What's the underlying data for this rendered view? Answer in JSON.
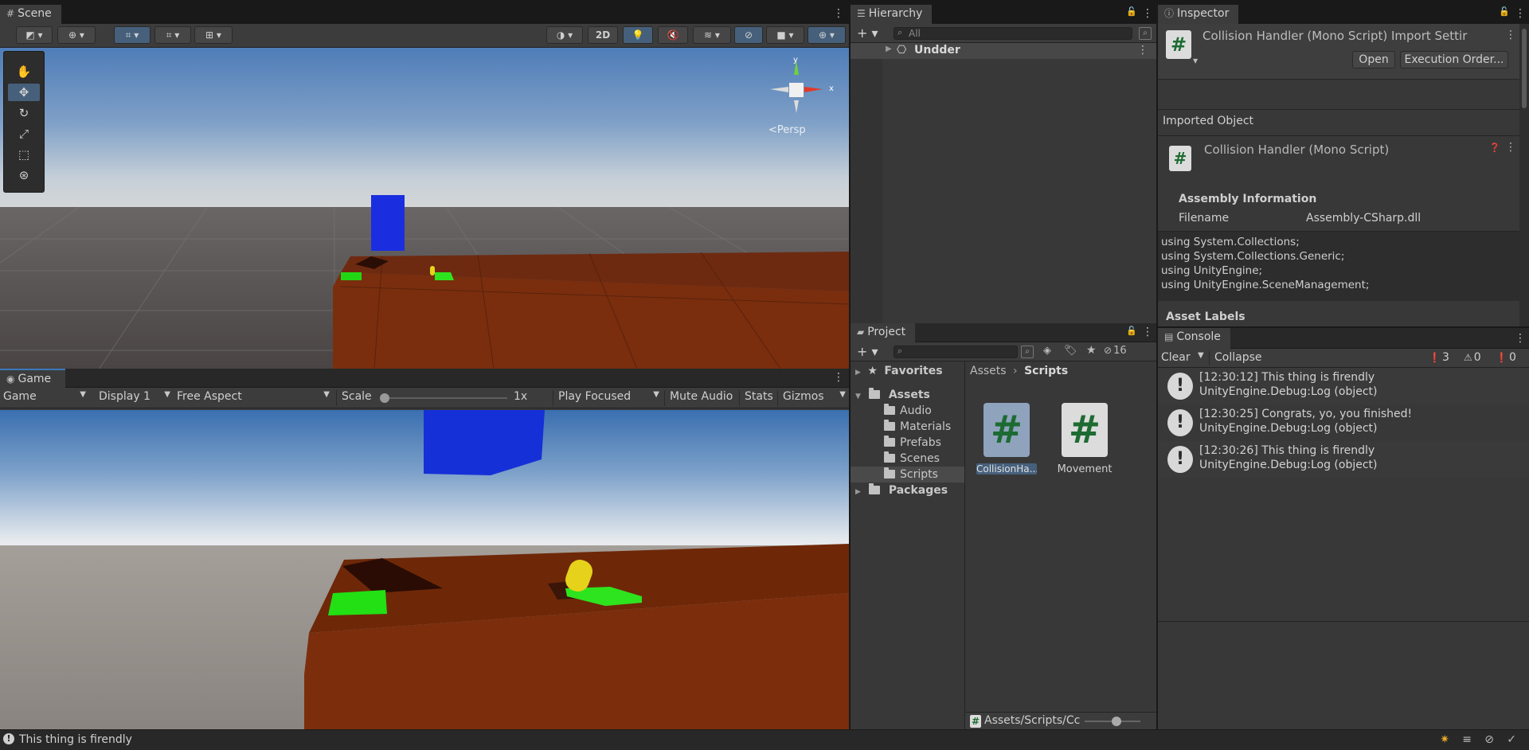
{
  "scene": {
    "tab_label": "Scene",
    "toolbar": {
      "btn_2d": "2D"
    },
    "gizmo": {
      "axis_x": "x",
      "axis_y": "y",
      "persp_label": "<Persp"
    }
  },
  "game": {
    "tab_label": "Game",
    "toolbar": {
      "mode": "Game",
      "display": "Display 1",
      "aspect": "Free Aspect",
      "scale_label": "Scale",
      "scale_value": "1x",
      "scale_level": 0,
      "play_mode": "Play Focused",
      "mute": "Mute Audio",
      "stats": "Stats",
      "gizmos": "Gizmos"
    }
  },
  "hierarchy": {
    "tab_label": "Hierarchy",
    "search_placeholder": "All",
    "scene_name": "Undder"
  },
  "inspector": {
    "tab_label": "Inspector",
    "title": "Collision Handler (Mono Script) Import Settir",
    "open_label": "Open",
    "execution_order_label": "Execution Order...",
    "imported_object_label": "Imported Object",
    "imported_object_title": "Collision Handler (Mono Script)",
    "assembly_header": "Assembly Information",
    "filename_label": "Filename",
    "filename_value": "Assembly-CSharp.dll",
    "code_lines": [
      "using System.Collections;",
      "using System.Collections.Generic;",
      "using UnityEngine;",
      "using UnityEngine.SceneManagement;"
    ],
    "asset_labels": "Asset Labels"
  },
  "project": {
    "tab_label": "Project",
    "hidden_count": "16",
    "tree": [
      {
        "label": "Favorites",
        "depth": 0,
        "bold": true
      },
      {
        "label": "Assets",
        "depth": 0,
        "bold": true
      },
      {
        "label": "Audio",
        "depth": 1
      },
      {
        "label": "Materials",
        "depth": 1
      },
      {
        "label": "Prefabs",
        "depth": 1
      },
      {
        "label": "Scenes",
        "depth": 1
      },
      {
        "label": "Scripts",
        "depth": 1,
        "selected": true
      },
      {
        "label": "Packages",
        "depth": 0,
        "bold": true
      }
    ],
    "breadcrumb_root": "Assets",
    "breadcrumb_current": "Scripts",
    "files": [
      {
        "label": "CollisionHa..."
      },
      {
        "label": "Movement"
      }
    ],
    "footer_path": "Assets/Scripts/Cc"
  },
  "console": {
    "tab_label": "Console",
    "clear_label": "Clear",
    "collapse_label": "Collapse",
    "count_logs": "3",
    "count_warnings": "0",
    "count_errors": "0",
    "entries": [
      {
        "line1": "[12:30:12] This thing is firendly",
        "line2": "UnityEngine.Debug:Log (object)"
      },
      {
        "line1": "[12:30:25] Congrats, yo, you finished!",
        "line2": "UnityEngine.Debug:Log (object)"
      },
      {
        "line1": "[12:30:26] This thing is firendly",
        "line2": "UnityEngine.Debug:Log (object)"
      }
    ]
  },
  "status_bar": {
    "message": "This thing is firendly"
  }
}
